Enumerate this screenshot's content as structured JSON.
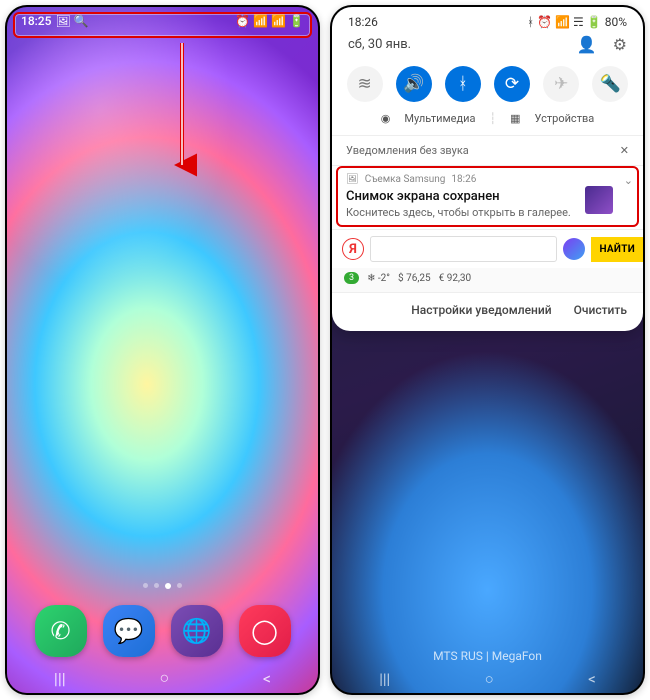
{
  "left": {
    "status": {
      "time": "18:25",
      "icons_left": "🖼 🔍",
      "icons_right": "⏰ 📶 📶 🔋"
    },
    "dock": [
      "phone",
      "messages",
      "browser",
      "camera"
    ],
    "nav": [
      "|||",
      "○",
      "<"
    ]
  },
  "right": {
    "status": {
      "time": "18:26",
      "icons": "ᚼ ⏰ 📶 ☴ 🔋",
      "battery": "80%"
    },
    "date": "сб, 30 янв.",
    "actions": [
      "user",
      "settings"
    ],
    "toggles": [
      {
        "name": "wifi",
        "on": false,
        "glyph": "≋"
      },
      {
        "name": "sound",
        "on": true,
        "glyph": "🔊"
      },
      {
        "name": "bluetooth",
        "on": true,
        "glyph": "ᚼ"
      },
      {
        "name": "rotate",
        "on": true,
        "glyph": "⟳"
      },
      {
        "name": "airplane",
        "on": false,
        "glyph": "✈",
        "off": true
      },
      {
        "name": "flashlight",
        "on": false,
        "glyph": "🔦",
        "off": true
      }
    ],
    "media": {
      "label": "Мультимедиа",
      "devices": "Устройства"
    },
    "silent": {
      "label": "Уведомления без звука",
      "close": "✕"
    },
    "notif": {
      "app": "Съемка Samsung",
      "time": "18:26",
      "title": "Снимок экрана сохранен",
      "subtitle": "Коснитесь здесь, чтобы открыть в галерее."
    },
    "yandex": {
      "logo": "Я",
      "find": "НАЙТИ",
      "weather": {
        "badge": "3",
        "temp": "❄ -2°",
        "usd": "$ 76,25",
        "eur": "€ 92,30"
      }
    },
    "footer": {
      "settings": "Настройки уведомлений",
      "clear": "Очистить"
    },
    "carrier": "MTS RUS | MegaFon",
    "nav": [
      "|||",
      "○",
      "<"
    ]
  }
}
